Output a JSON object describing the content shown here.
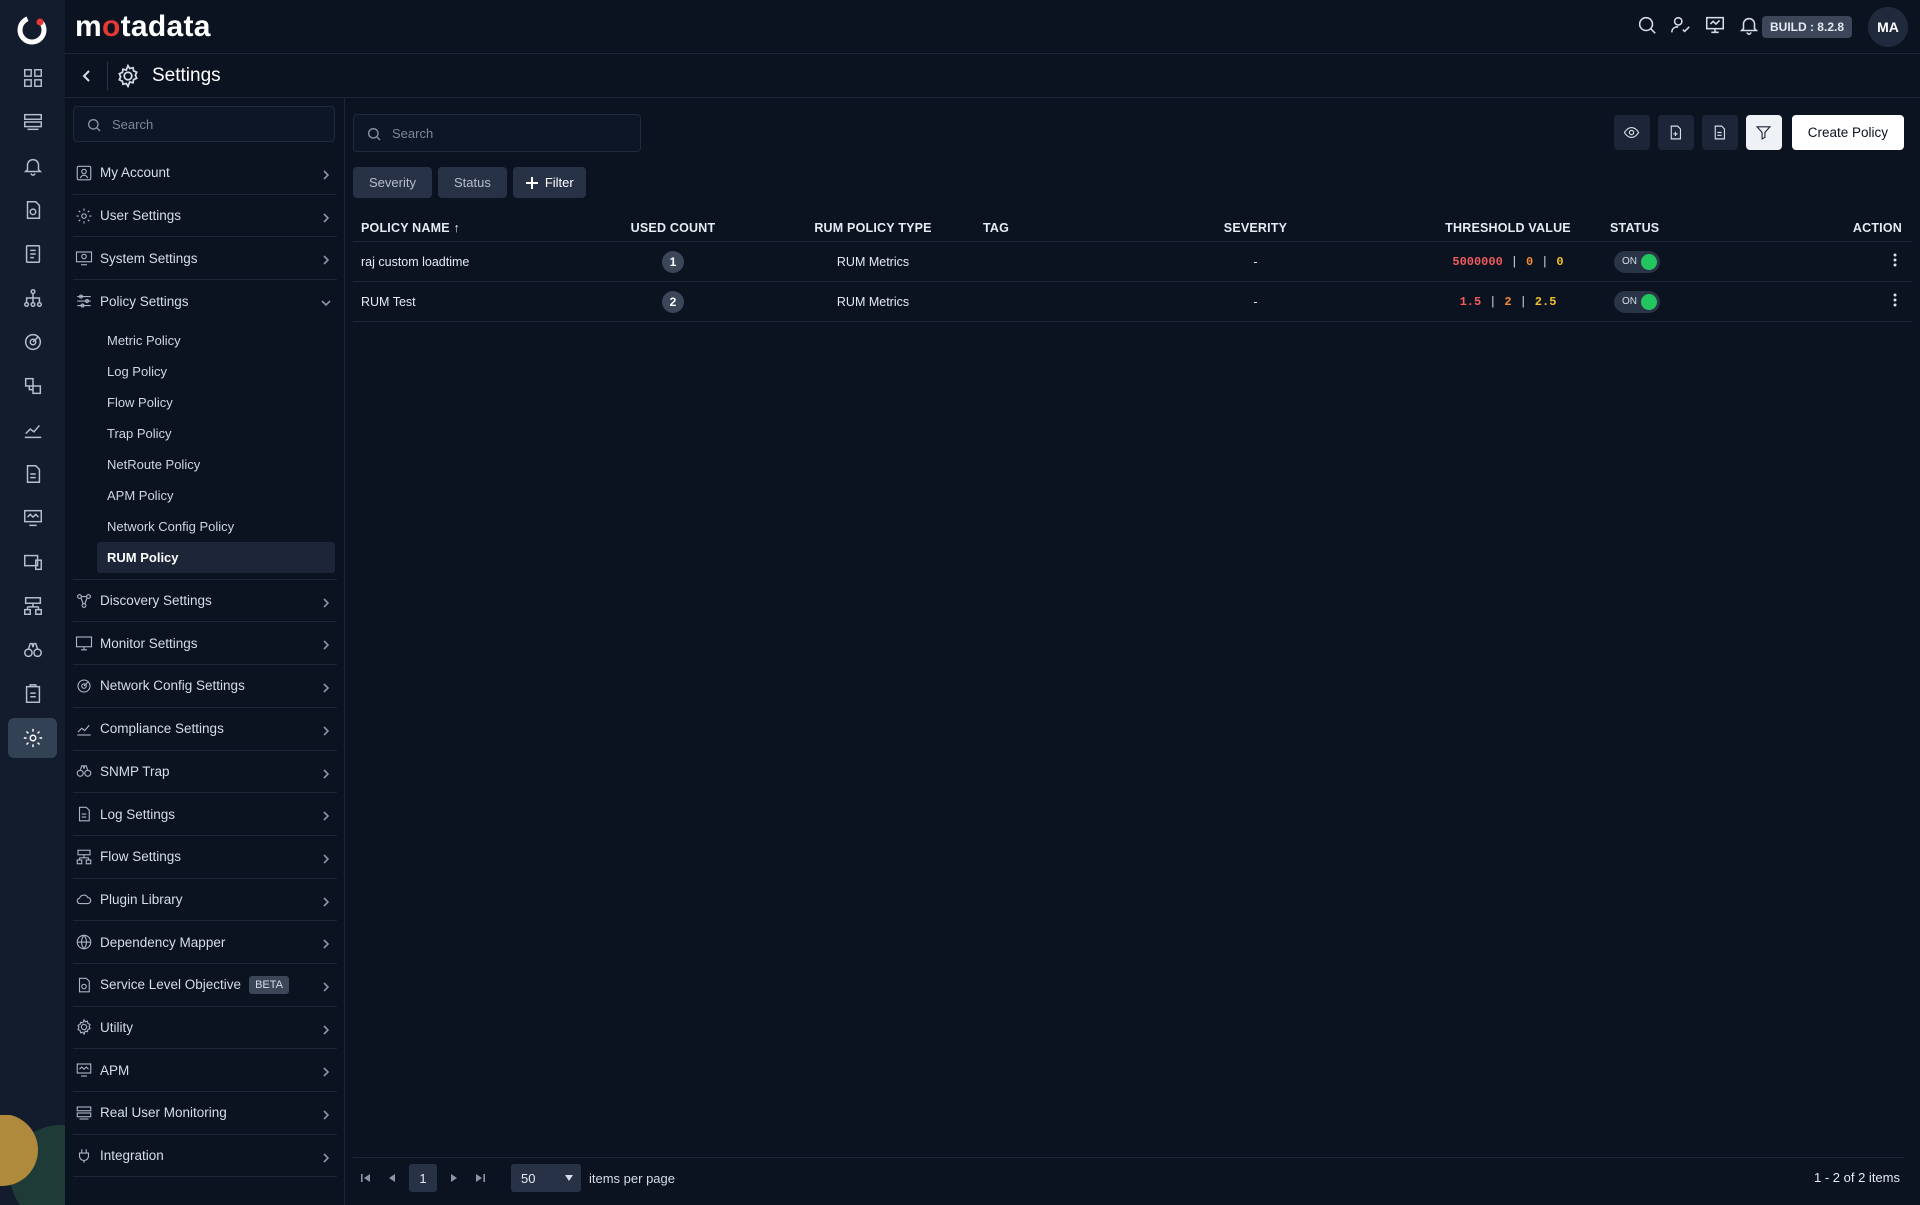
{
  "app": {
    "brand_prefix": "m",
    "brand_dot": "o",
    "brand_suffix": "tadata",
    "build": "BUILD : 8.2.8",
    "avatar_initials": "MA"
  },
  "page": {
    "title": "Settings"
  },
  "sidebar": {
    "search_placeholder": "Search",
    "items": [
      {
        "label": "My Account",
        "icon": "user-icon"
      },
      {
        "label": "User Settings",
        "icon": "user-gear-icon"
      },
      {
        "label": "System Settings",
        "icon": "monitor-gear-icon"
      },
      {
        "label": "Policy Settings",
        "icon": "sliders-icon"
      },
      {
        "label": "Discovery Settings",
        "icon": "discovery-icon"
      },
      {
        "label": "Monitor Settings",
        "icon": "monitor-icon"
      },
      {
        "label": "Network Config Settings",
        "icon": "network-config-icon"
      },
      {
        "label": "Compliance Settings",
        "icon": "chart-line-icon"
      },
      {
        "label": "SNMP Trap",
        "icon": "binoculars-icon"
      },
      {
        "label": "Log Settings",
        "icon": "document-icon"
      },
      {
        "label": "Flow Settings",
        "icon": "flow-icon"
      },
      {
        "label": "Plugin Library",
        "icon": "cloud-icon"
      },
      {
        "label": "Dependency Mapper",
        "icon": "globe-icon"
      },
      {
        "label": "Service Level Objective",
        "icon": "slo-icon",
        "badge": "BETA"
      },
      {
        "label": "Utility",
        "icon": "gear-icon"
      },
      {
        "label": "APM",
        "icon": "apm-icon"
      },
      {
        "label": "Real User Monitoring",
        "icon": "rum-icon"
      },
      {
        "label": "Integration",
        "icon": "plug-icon"
      }
    ],
    "policy_sub_items": [
      "Metric Policy",
      "Log Policy",
      "Flow Policy",
      "Trap Policy",
      "NetRoute Policy",
      "APM Policy",
      "Network Config Policy",
      "RUM Policy"
    ],
    "active_sub_item": "RUM Policy"
  },
  "main": {
    "search_placeholder": "Search",
    "create_label": "Create Policy",
    "filters": {
      "severity": "Severity",
      "status": "Status",
      "add": "Filter"
    },
    "columns": {
      "policy_name": "POLICY NAME",
      "sort_indicator": "↑",
      "used_count": "USED COUNT",
      "rum_policy_type": "RUM POLICY TYPE",
      "tag": "TAG",
      "severity": "SEVERITY",
      "threshold_value": "THRESHOLD VALUE",
      "status": "STATUS",
      "action": "ACTION"
    },
    "rows": [
      {
        "name": "raj custom loadtime",
        "used_count": "1",
        "type": "RUM Metrics",
        "tag": "",
        "severity": "-",
        "threshold_critical": "5000000",
        "threshold_major": "0",
        "threshold_warning": "0",
        "separator": "|",
        "status": "ON"
      },
      {
        "name": "RUM Test",
        "used_count": "2",
        "type": "RUM Metrics",
        "tag": "",
        "severity": "-",
        "threshold_critical": "1.5",
        "threshold_major": "2",
        "threshold_warning": "2.5",
        "separator": "|",
        "status": "ON"
      }
    ],
    "pagination": {
      "page": "1",
      "per_page": "50",
      "per_page_label": "items per page",
      "range": "1 - 2 of 2 items"
    }
  },
  "colors": {
    "critical": "#f25c5c",
    "major": "#f28b30",
    "warning": "#f2c12e",
    "toggle_on": "#22c55e",
    "background": "#0b1220"
  }
}
